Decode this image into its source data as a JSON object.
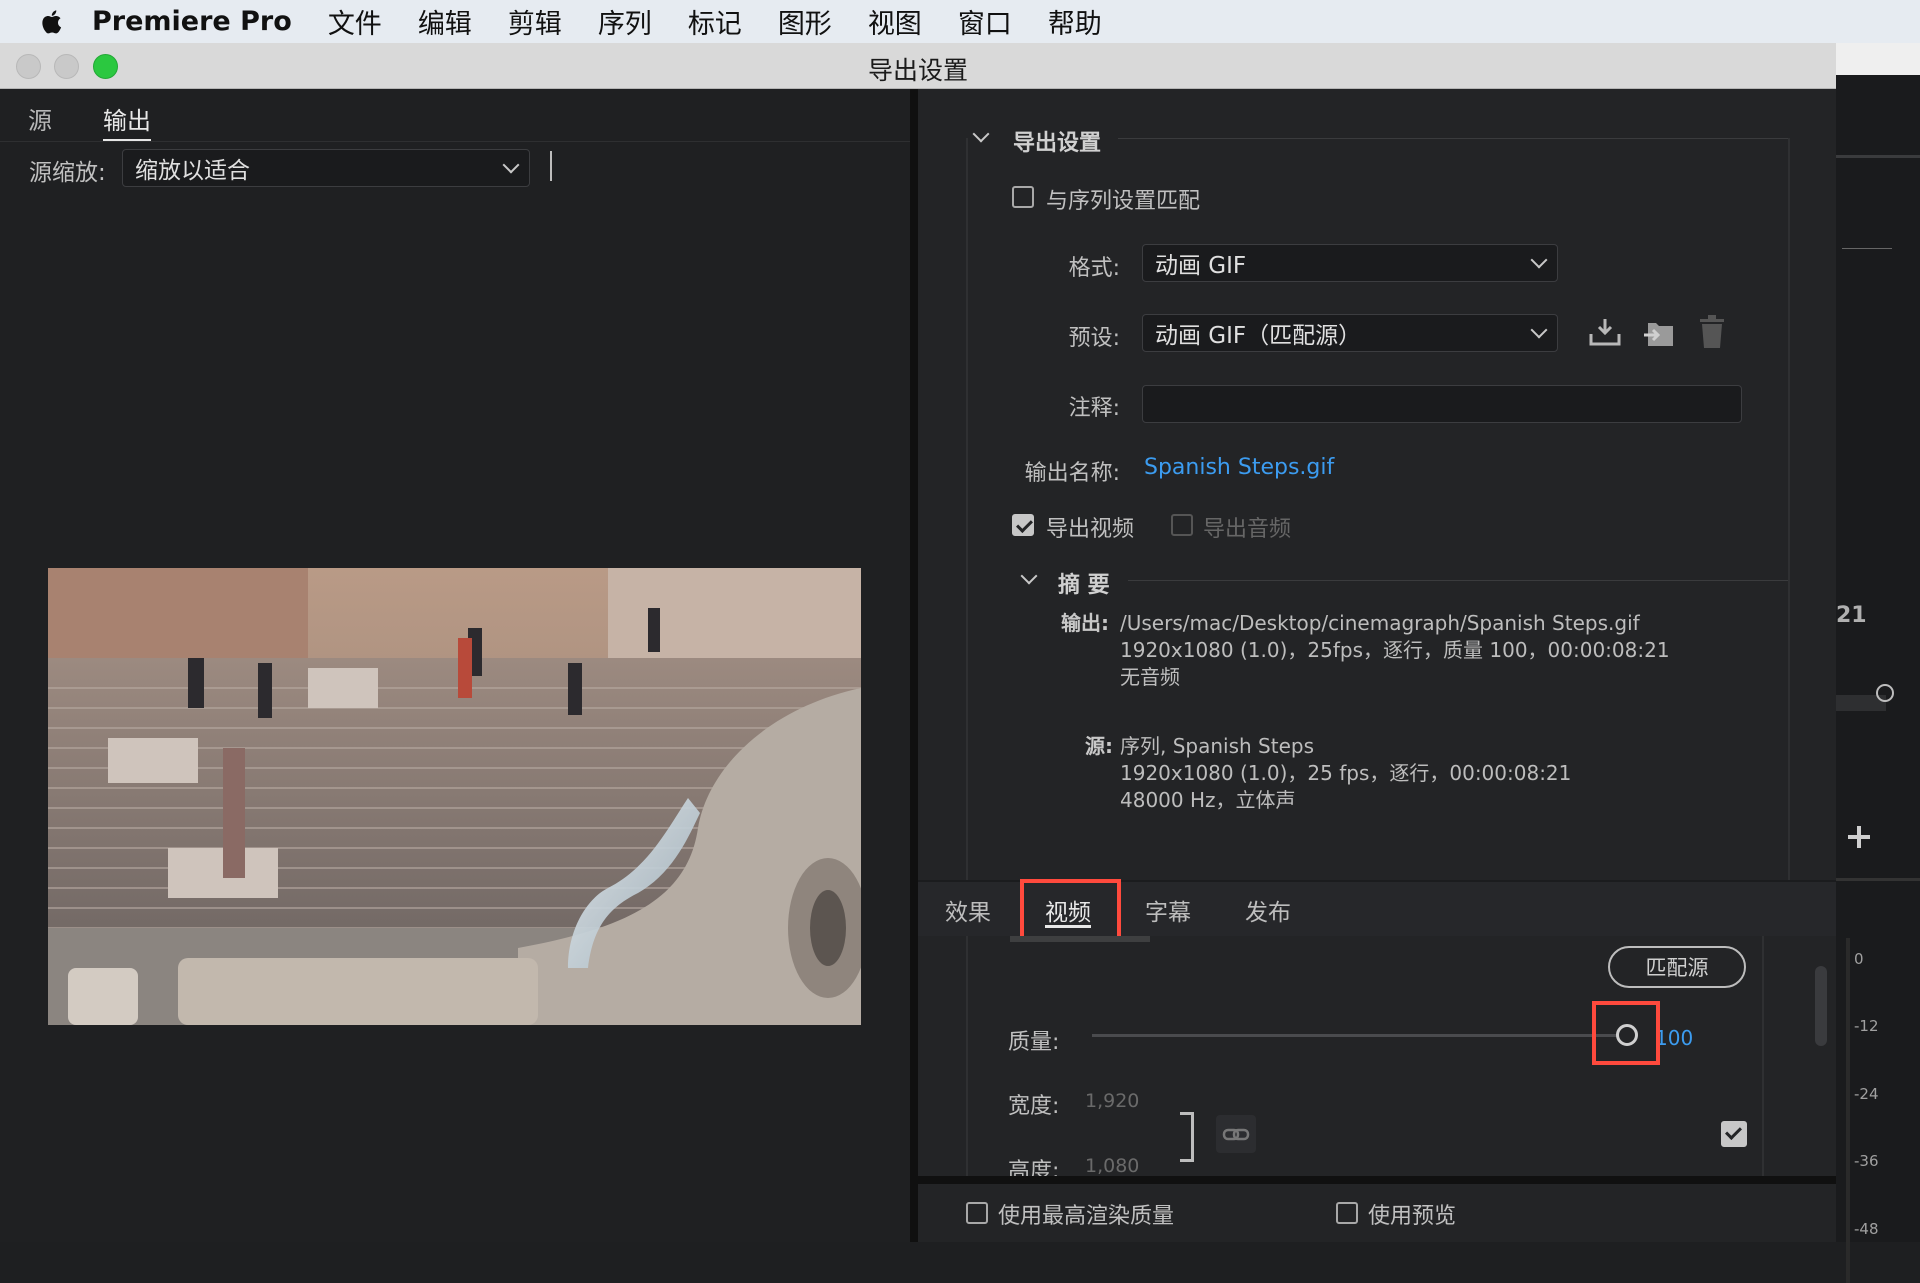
{
  "menubar": {
    "app_name": "Premiere Pro",
    "items": [
      "文件",
      "编辑",
      "剪辑",
      "序列",
      "标记",
      "图形",
      "视图",
      "窗口",
      "帮助"
    ]
  },
  "window": {
    "title": "导出设置"
  },
  "left": {
    "tabs": [
      "源",
      "输出"
    ],
    "active_tab": "输出",
    "scale_label": "源缩放:",
    "scale_value": "缩放以适合"
  },
  "export_settings": {
    "section_title": "导出设置",
    "match_sequence_label": "与序列设置匹配",
    "match_sequence_checked": false,
    "format_label": "格式:",
    "format_value": "动画 GIF",
    "preset_label": "预设:",
    "preset_value": "动画 GIF（匹配源）",
    "comment_label": "注释:",
    "comment_value": "",
    "output_name_label": "输出名称:",
    "output_name_value": "Spanish Steps.gif",
    "export_video_label": "导出视频",
    "export_video_checked": true,
    "export_audio_label": "导出音频",
    "export_audio_checked": false
  },
  "summary": {
    "title": "摘 要",
    "output_label": "输出:",
    "output_lines": [
      "/Users/mac/Desktop/cinemagraph/Spanish Steps.gif",
      "1920x1080 (1.0)，25fps，逐行，质量 100，00:00:08:21",
      "无音频"
    ],
    "source_label": "源:",
    "source_lines": [
      "序列, Spanish Steps",
      "1920x1080 (1.0)，25 fps，逐行，00:00:08:21",
      "48000 Hz，立体声"
    ]
  },
  "bottom_tabs": [
    "效果",
    "视频",
    "字幕",
    "发布"
  ],
  "active_bottom_tab": "视频",
  "video": {
    "match_source_label": "匹配源",
    "quality_label": "质量:",
    "quality_value": "100",
    "quality_fraction": 1.0,
    "width_label": "宽度:",
    "width_value": "1,920",
    "height_label": "高度:",
    "height_value": "1,080"
  },
  "footer": {
    "max_render_label": "使用最高渲染质量",
    "use_preview_label": "使用预览"
  },
  "behind": {
    "timecode_fragment": "21"
  },
  "meter": {
    "ticks": [
      "0",
      "-12",
      "-24",
      "-36",
      "-48"
    ]
  },
  "colors": {
    "accent_link": "#3c9cf0",
    "highlight": "#ff4a3d"
  }
}
